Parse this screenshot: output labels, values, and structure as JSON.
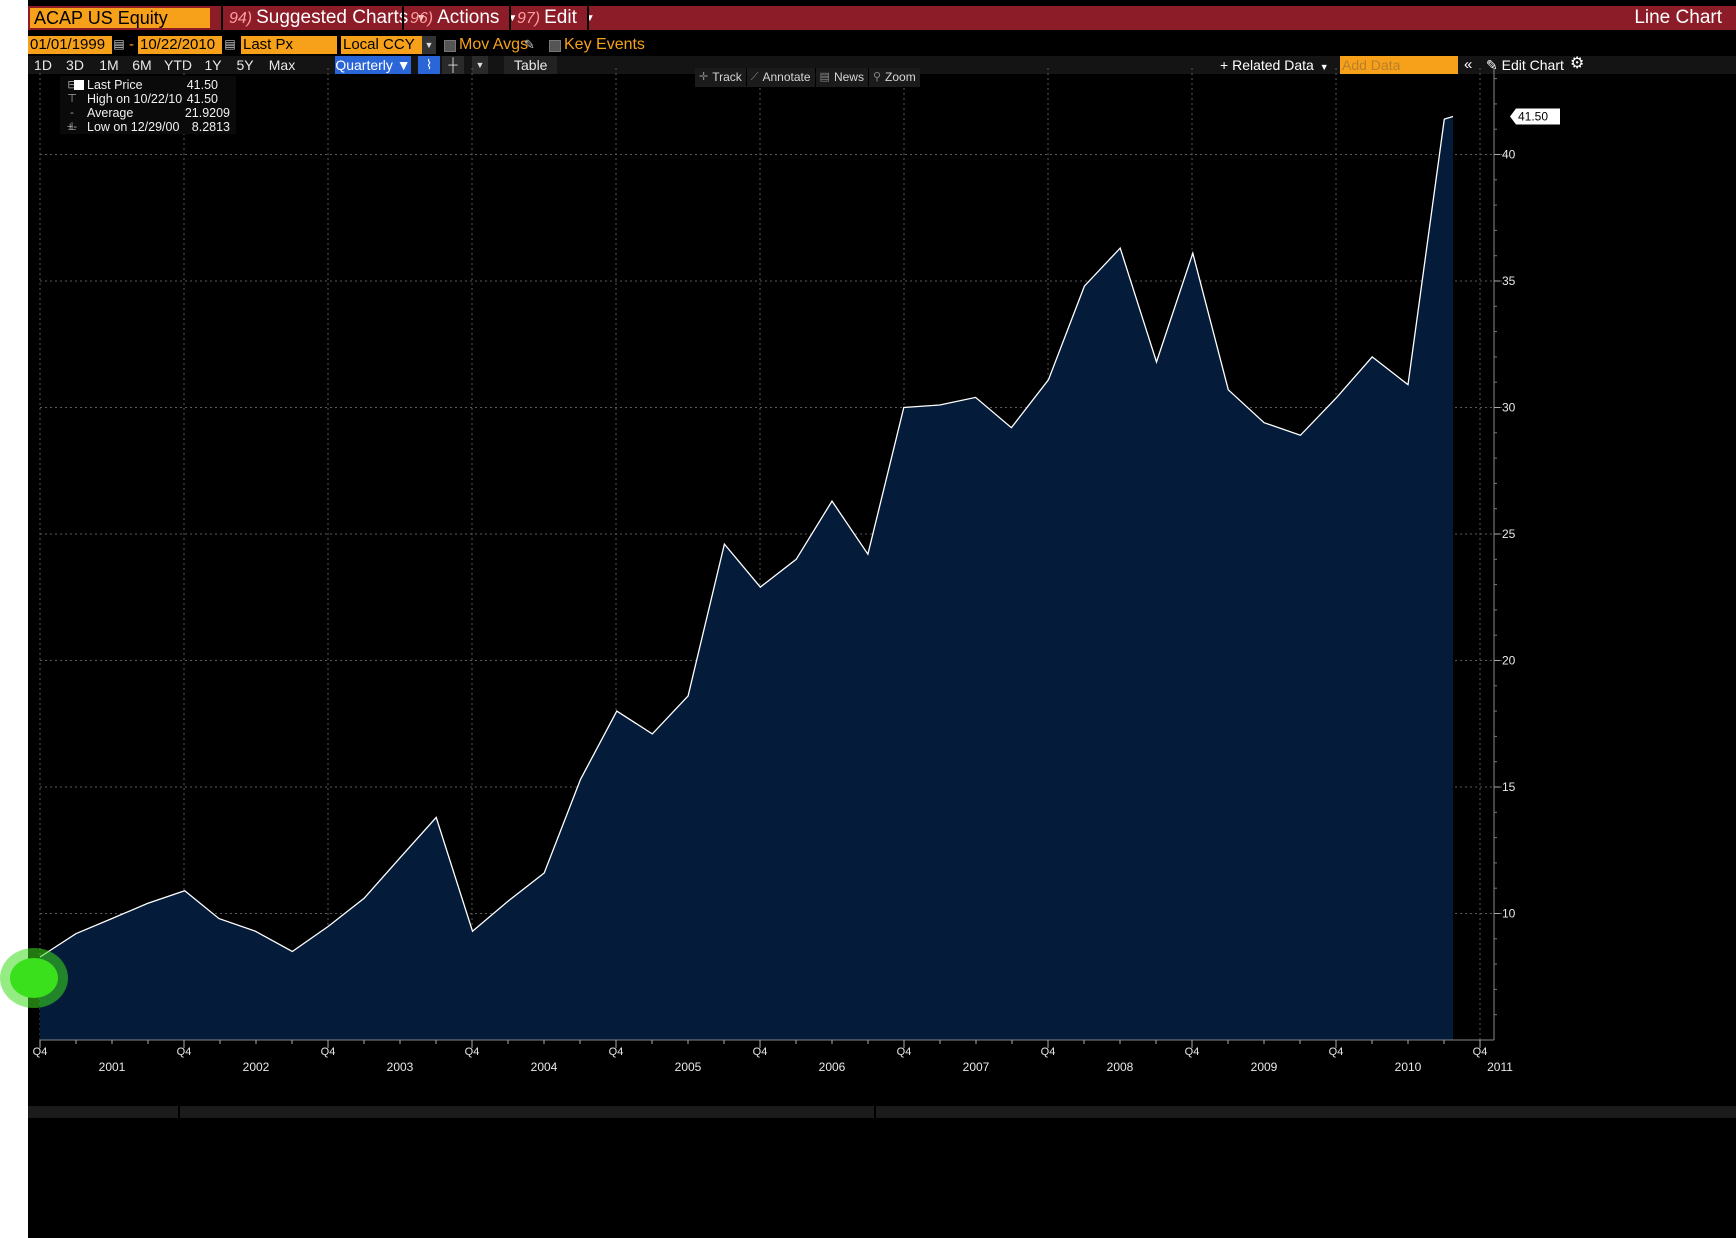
{
  "header": {
    "ticker": "ACAP US Equity",
    "menus": [
      {
        "num": "94)",
        "label": "Suggested Charts"
      },
      {
        "num": "96)",
        "label": "Actions"
      },
      {
        "num": "97)",
        "label": "Edit"
      }
    ],
    "chart_type_label": "Line Chart"
  },
  "settings": {
    "start_date": "01/01/1999",
    "end_date": "10/22/2010",
    "separator": "-",
    "field": "Last Px",
    "currency": "Local CCY",
    "mov_avgs_label": "Mov Avgs",
    "key_events_label": "Key Events"
  },
  "toolbar": {
    "ranges": [
      "1D",
      "3D",
      "1M",
      "6M",
      "YTD",
      "1Y",
      "5Y",
      "Max"
    ],
    "frequency": "Quarterly ▼",
    "table_label": "Table",
    "related_data_label": "Related Data",
    "add_data_placeholder": "Add Data",
    "collapse_glyph": "«",
    "edit_chart_label": "Edit Chart"
  },
  "chart_tools": {
    "track": "Track",
    "annotate": "Annotate",
    "news": "News",
    "zoom": "Zoom"
  },
  "legend": {
    "last_price_label": "Last Price",
    "last_price_value": "41.50",
    "high_label": "High on 10/22/10",
    "high_value": "41.50",
    "average_label": "Average",
    "average_value": "21.9209",
    "low_label": "Low on 12/29/00",
    "low_value": "8.2813"
  },
  "colors": {
    "title_bar": "#8c1c27",
    "accent_orange": "#f7a11a",
    "area_fill": "#041b3a",
    "line": "#ffffff",
    "grid": "#555555",
    "active_blue": "#2b66d9"
  },
  "icons": {
    "calendar": "calendar-icon",
    "pencil": "pencil-icon",
    "gear": "gear-icon",
    "track": "crosshair-icon",
    "annotate": "annotate-icon",
    "news": "news-icon",
    "zoom": "magnifier-icon"
  },
  "chart_data": {
    "type": "area",
    "x_dates": [
      "2000-12-29",
      "2001-03-30",
      "2001-06-29",
      "2001-09-28",
      "2001-12-31",
      "2002-03-28",
      "2002-06-28",
      "2002-09-30",
      "2002-12-31",
      "2003-03-31",
      "2003-06-30",
      "2003-09-30",
      "2003-12-31",
      "2004-03-31",
      "2004-06-30",
      "2004-09-30",
      "2004-12-31",
      "2005-03-31",
      "2005-06-30",
      "2005-09-30",
      "2005-12-30",
      "2006-03-31",
      "2006-06-30",
      "2006-09-29",
      "2006-12-29",
      "2007-03-30",
      "2007-06-29",
      "2007-09-28",
      "2007-12-31",
      "2008-03-31",
      "2008-06-30",
      "2008-09-30",
      "2008-12-31",
      "2009-03-31",
      "2009-06-30",
      "2009-09-30",
      "2009-12-31",
      "2010-03-31",
      "2010-06-30",
      "2010-09-30",
      "2010-10-22"
    ],
    "values": [
      8.28,
      9.2,
      9.8,
      10.4,
      10.9,
      9.8,
      9.3,
      8.5,
      9.5,
      10.6,
      12.2,
      13.8,
      9.3,
      10.5,
      11.6,
      15.3,
      18.0,
      17.1,
      18.6,
      24.6,
      22.9,
      24.0,
      26.3,
      24.2,
      30.0,
      30.1,
      30.4,
      29.2,
      31.1,
      34.8,
      36.3,
      31.8,
      36.1,
      30.7,
      29.4,
      28.9,
      30.4,
      32.0,
      30.9,
      41.4,
      41.5
    ],
    "ylim": [
      5,
      44
    ],
    "y_ticks": [
      "10",
      "15",
      "20",
      "25",
      "30",
      "35",
      "40"
    ],
    "x_quarter_label": "Q4",
    "x_year_labels": [
      "2001",
      "2002",
      "2003",
      "2004",
      "2005",
      "2006",
      "2007",
      "2008",
      "2009",
      "2010",
      "2011"
    ],
    "last_value_label": "41.50",
    "grid": true
  }
}
